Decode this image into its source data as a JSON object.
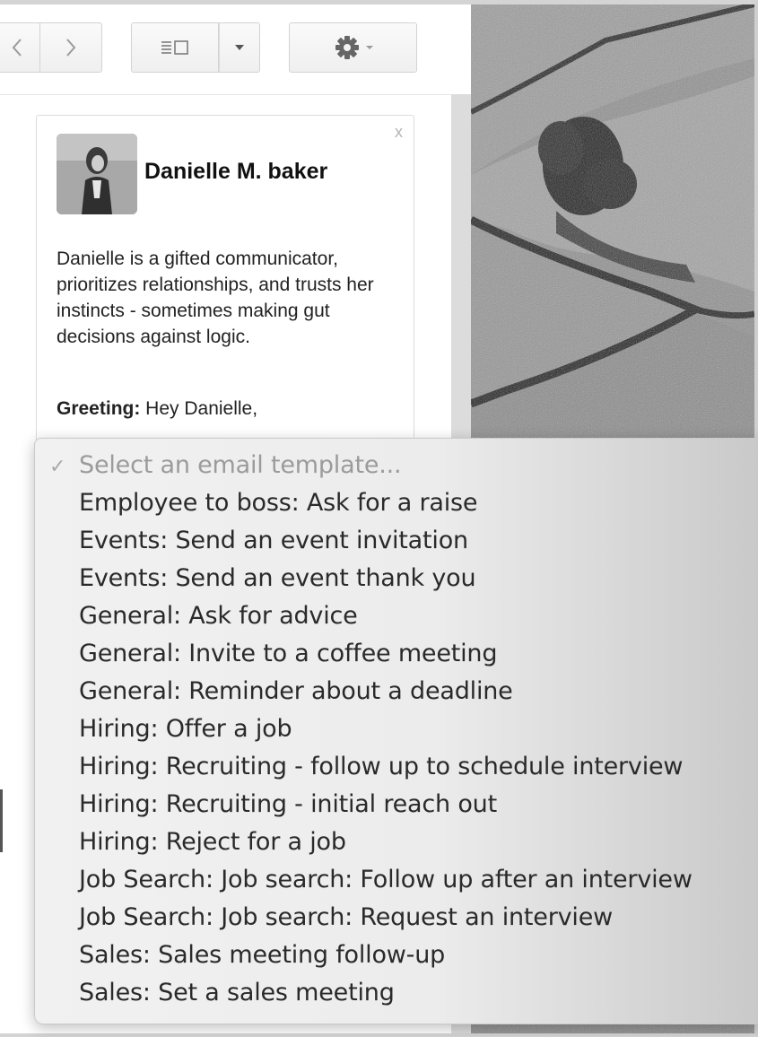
{
  "toolbar": {
    "prev_icon": "chevron-left-icon",
    "next_icon": "chevron-right-icon",
    "view_icon": "split-view-icon",
    "view_dropdown_icon": "caret-down-icon",
    "settings_icon": "gear-icon"
  },
  "contact": {
    "name": "Danielle M. baker",
    "close": "x",
    "bio": "Danielle is a gifted communicator, prioritizes relationships, and trusts her instincts - sometimes making gut decisions against logic.",
    "greeting_label": "Greeting:",
    "greeting_value": " Hey Danielle,"
  },
  "template_menu": {
    "check": "✓",
    "placeholder": "Select an email template...",
    "options": [
      "Employee to boss: Ask for a raise",
      "Events: Send an event invitation",
      "Events: Send an event thank you",
      "General: Ask for advice",
      "General: Invite to a coffee meeting",
      "General: Reminder about a deadline",
      "Hiring: Offer a job",
      "Hiring: Recruiting - follow up to schedule interview",
      "Hiring: Recruiting - initial reach out",
      "Hiring: Reject for a job",
      "Job Search: Job search: Follow up after an interview",
      "Job Search: Job search: Request an interview",
      "Sales: Sales meeting follow-up",
      "Sales: Set a sales meeting"
    ]
  }
}
